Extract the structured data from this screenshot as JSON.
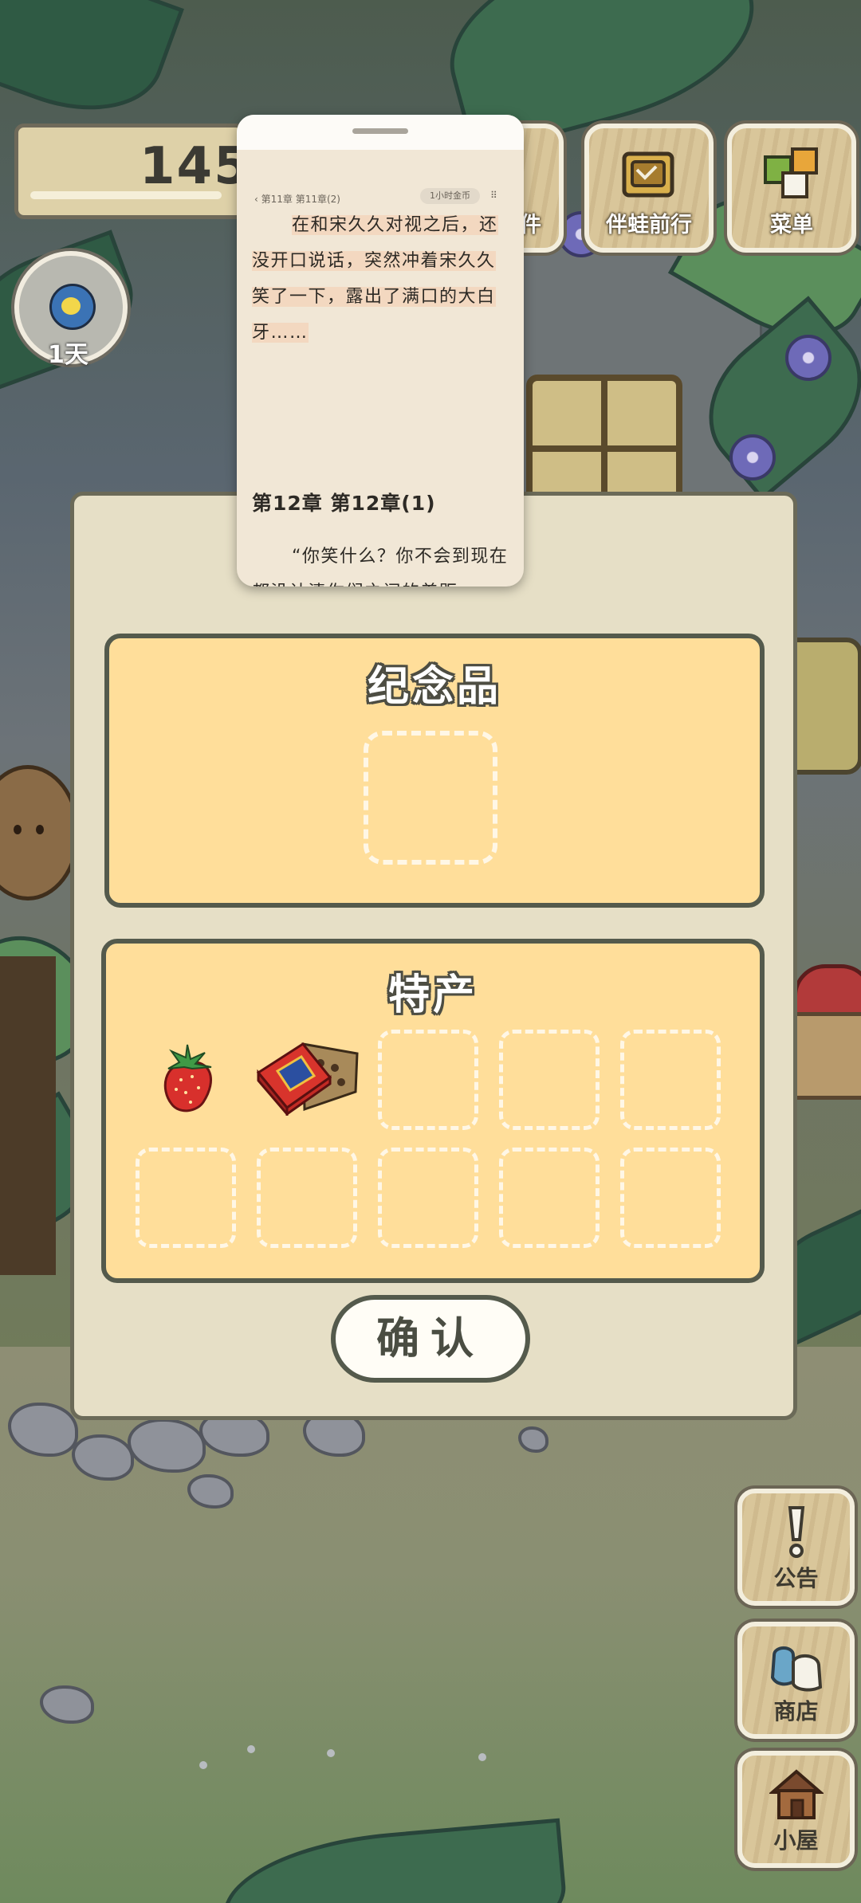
{
  "hud": {
    "coins": "145",
    "day": "1天"
  },
  "top_buttons": [
    {
      "label": "件",
      "icon": "items-icon"
    },
    {
      "label": "伴蛙前行",
      "icon": "map-icon"
    },
    {
      "label": "菜单",
      "icon": "menu-squares-icon"
    }
  ],
  "side_buttons": [
    {
      "label": "公告",
      "icon": "exclamation-icon"
    },
    {
      "label": "商店",
      "icon": "shop-bags-icon"
    },
    {
      "label": "小屋",
      "icon": "house-icon"
    }
  ],
  "dialog": {
    "title_fragment": "",
    "souvenir": {
      "title": "纪念品",
      "slots": 1
    },
    "specialty": {
      "title": "特产",
      "items": [
        {
          "name": "strawberry",
          "icon": "strawberry-icon"
        },
        {
          "name": "gift-box",
          "icon": "gift-box-icon"
        }
      ],
      "empty_slots": 8
    },
    "confirm_label": "确认"
  },
  "reader": {
    "back_label": "第11章 第11章(2)",
    "chip_label": "1小时金币",
    "para1": "在和宋久久对视之后，还没开口说话，突然冲着宋久久笑了一下，露出了满口的大白牙……",
    "chapter_heading": "第12章 第12章(1)",
    "para2": "“你笑什么？你不会到现在都没认清你们之间的差距吧？”囡囡余光扫到莫一刀的这个笑，忍不住瞪了他一眼，直接"
  },
  "colors": {
    "section_fill": "#ffde9a",
    "dialog_fill": "#e6dfc6",
    "outline": "#545a4c"
  }
}
